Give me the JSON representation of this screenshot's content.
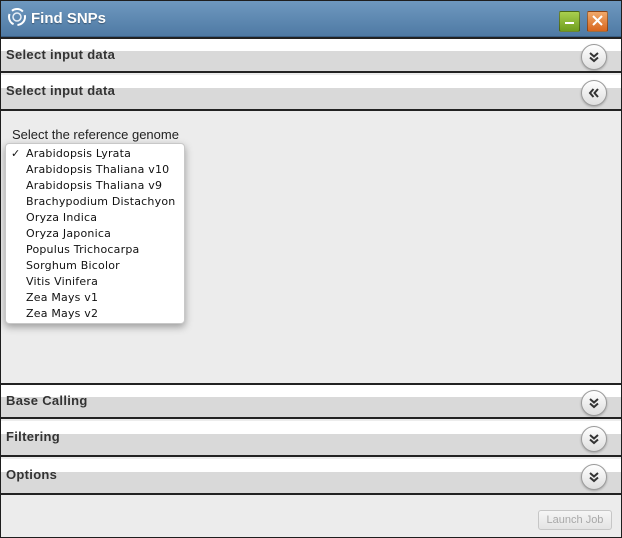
{
  "window": {
    "title": "Find SNPs",
    "icons": {
      "logo": "swirl-logo-icon",
      "minimize": "minimize-icon",
      "close": "close-icon"
    }
  },
  "panels": [
    {
      "title": "Select input data",
      "state": "collapsed"
    },
    {
      "title": "Select input data",
      "state": "expanded"
    },
    {
      "title": "Base Calling",
      "state": "collapsed"
    },
    {
      "title": "Filtering",
      "state": "collapsed"
    },
    {
      "title": "Options",
      "state": "collapsed"
    }
  ],
  "reference_genome": {
    "label": "Select the reference genome",
    "selected": "Arabidopsis Lyrata",
    "options": [
      "Arabidopsis Lyrata",
      "Arabidopsis Thaliana v10",
      "Arabidopsis Thaliana v9",
      "Brachypodium Distachyon",
      "Oryza Indica",
      "Oryza Japonica",
      "Populus Trichocarpa",
      "Sorghum Bicolor",
      "Vitis Vinifera",
      "Zea Mays v1",
      "Zea Mays v2"
    ],
    "check_symbol": "✓"
  },
  "footer": {
    "launch_label": "Launch Job",
    "launch_enabled": false
  },
  "colors": {
    "titlebar": "#5a85ad",
    "minimize": "#8bbd35",
    "close": "#e67d35",
    "panel_header": "#d9d9d9",
    "body": "#ececec"
  }
}
